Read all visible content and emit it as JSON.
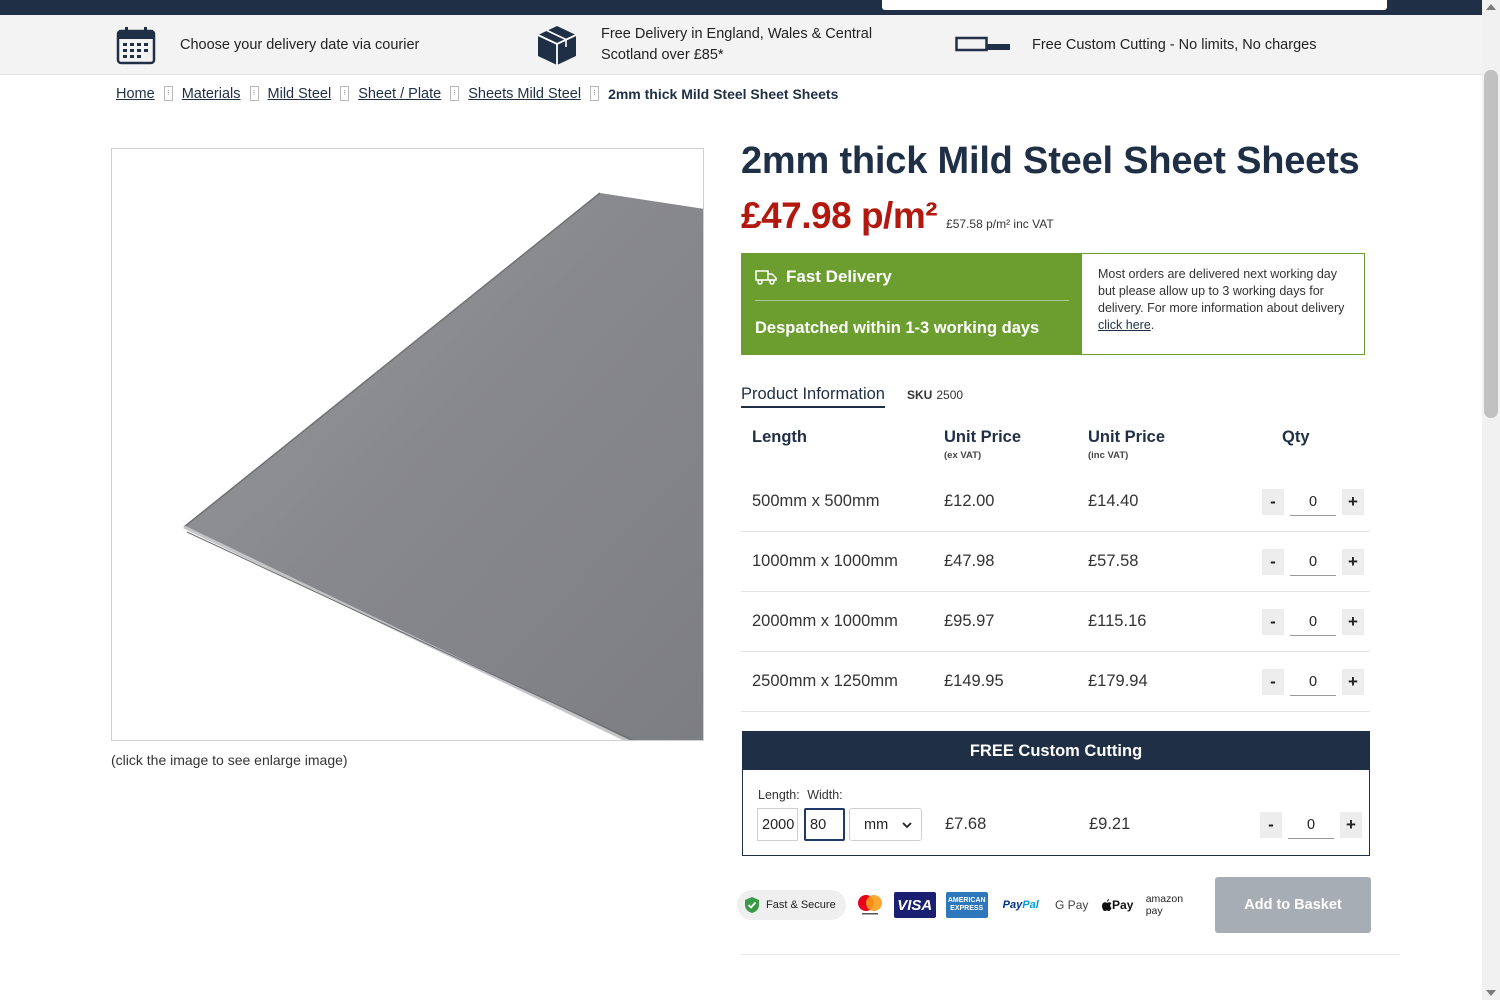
{
  "usp": {
    "delivery_date": "Choose your delivery date via courier",
    "free_delivery": "Free Delivery in England, Wales & Central Scotland over £85*",
    "custom_cutting": "Free Custom Cutting - No limits, No charges"
  },
  "breadcrumb": {
    "items": [
      "Home",
      "Materials",
      "Mild Steel",
      "Sheet / Plate",
      "Sheets Mild Steel"
    ],
    "current": "2mm thick Mild Steel Sheet Sheets"
  },
  "product": {
    "title": "2mm thick Mild Steel Sheet Sheets",
    "price": "£47.98 p/m²",
    "price_inc_vat": "£57.58 p/m² inc VAT",
    "image_caption": "(click the image to see enlarge image)"
  },
  "delivery": {
    "heading": "Fast Delivery",
    "despatch": "Despatched within 1-3 working days",
    "info_text": "Most orders are delivered next working day but please allow up to 3 working days for delivery. For more information about delivery ",
    "info_link": "click here",
    "info_end": "."
  },
  "info": {
    "tab_label": "Product Information",
    "sku_label": "SKU",
    "sku_value": "2500"
  },
  "price_table": {
    "headers": {
      "length": "Length",
      "unit_ex": "Unit Price",
      "unit_ex_sub": "(ex VAT)",
      "unit_inc": "Unit Price",
      "unit_inc_sub": "(inc VAT)",
      "qty": "Qty"
    },
    "rows": [
      {
        "length": "500mm x 500mm",
        "ex": "£12.00",
        "inc": "£14.40",
        "qty": "0"
      },
      {
        "length": "1000mm x 1000mm",
        "ex": "£47.98",
        "inc": "£57.58",
        "qty": "0"
      },
      {
        "length": "2000mm x 1000mm",
        "ex": "£95.97",
        "inc": "£115.16",
        "qty": "0"
      },
      {
        "length": "2500mm x 1250mm",
        "ex": "£149.95",
        "inc": "£179.94",
        "qty": "0"
      }
    ],
    "minus": "-",
    "plus": "+"
  },
  "cutting": {
    "heading": "FREE Custom Cutting",
    "length_label": "Length:",
    "width_label": "Width:",
    "length_value": "2000",
    "width_value": "80",
    "unit": "mm",
    "price_ex": "£7.68",
    "price_inc": "£9.21",
    "qty": "0"
  },
  "payments": {
    "secure": "Fast & Secure",
    "visa": "VISA",
    "amex": "AMERICAN EXPRESS",
    "paypal_a": "Pay",
    "paypal_b": "Pal",
    "gpay": "G Pay",
    "applepay": "Pay",
    "amazonpay": "amazon pay"
  },
  "add_to_basket": "Add to Basket",
  "colors": {
    "navy": "#1f2f45",
    "price_red": "#b3180f",
    "delivery_green": "#6b9e2f",
    "button_grey": "#a7adb4"
  }
}
